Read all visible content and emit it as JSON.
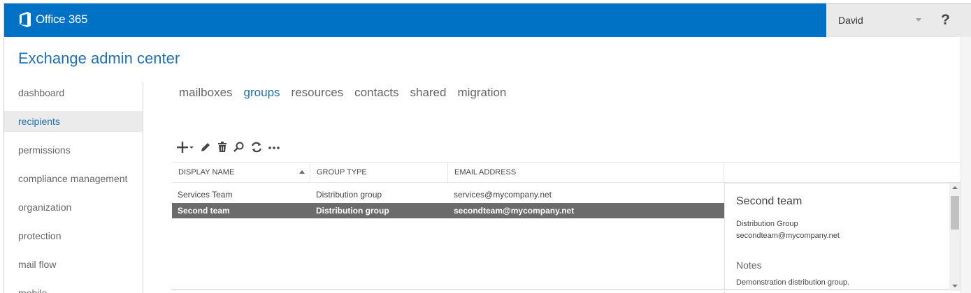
{
  "topbar": {
    "brand": "Office 365",
    "user_name": "David",
    "help_label": "?"
  },
  "app": {
    "title": "Exchange admin center"
  },
  "leftnav": {
    "items": [
      {
        "label": "dashboard",
        "selected": false
      },
      {
        "label": "recipients",
        "selected": true
      },
      {
        "label": "permissions",
        "selected": false
      },
      {
        "label": "compliance management",
        "selected": false
      },
      {
        "label": "organization",
        "selected": false
      },
      {
        "label": "protection",
        "selected": false
      },
      {
        "label": "mail flow",
        "selected": false
      },
      {
        "label": "mobile",
        "selected": false
      }
    ]
  },
  "tabs": [
    {
      "label": "mailboxes",
      "active": false
    },
    {
      "label": "groups",
      "active": true
    },
    {
      "label": "resources",
      "active": false
    },
    {
      "label": "contacts",
      "active": false
    },
    {
      "label": "shared",
      "active": false
    },
    {
      "label": "migration",
      "active": false
    }
  ],
  "toolbar": {
    "buttons": [
      "add-icon",
      "edit-icon",
      "delete-icon",
      "search-icon",
      "refresh-icon",
      "more-icon"
    ]
  },
  "grid": {
    "columns": [
      "DISPLAY NAME",
      "GROUP TYPE",
      "EMAIL ADDRESS"
    ],
    "sorted_column": "DISPLAY NAME",
    "rows": [
      {
        "display_name": "Services Team",
        "group_type": "Distribution group",
        "email": "services@mycompany.net",
        "selected": false
      },
      {
        "display_name": "Second team",
        "group_type": "Distribution group",
        "email": "secondteam@mycompany.net",
        "selected": true
      }
    ]
  },
  "details": {
    "name": "Second team",
    "type": "Distribution Group",
    "email": "secondteam@mycompany.net",
    "notes_heading": "Notes",
    "notes": "Demonstration distribution group."
  },
  "colors": {
    "brand_blue": "#0072c6",
    "accent_text": "#1f6fb3",
    "selected_row": "#6b6b6b"
  }
}
